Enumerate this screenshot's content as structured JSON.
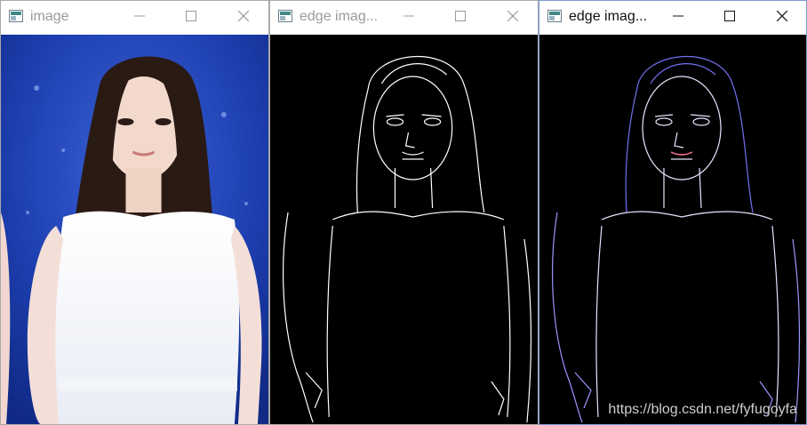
{
  "windows": [
    {
      "title": "image",
      "active": false
    },
    {
      "title": "edge imag...",
      "active": false
    },
    {
      "title": "edge imag...",
      "active": true
    }
  ],
  "icons": {
    "app": "image-window-icon",
    "minimize": "minimize-icon",
    "maximize": "maximize-icon",
    "close": "close-icon"
  },
  "colors": {
    "photo_background": "#1f40a8",
    "edge_background": "#000000",
    "edge_lines": "#ffffff",
    "color_edge_tint": "#7a78ff"
  },
  "watermark": "https://blog.csdn.net/fyfugoyfa"
}
